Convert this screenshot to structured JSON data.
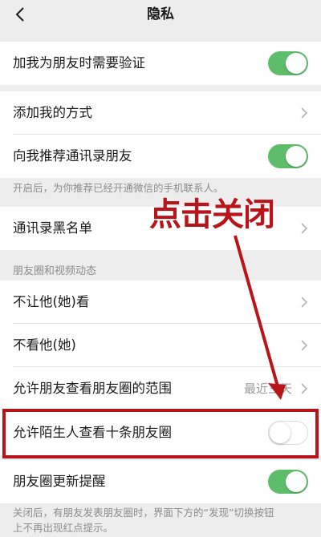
{
  "nav": {
    "title": "隐私",
    "back_icon": "chevron-left-icon"
  },
  "rows": {
    "verify": {
      "label": "加我为朋友时需要验证",
      "toggle": "on"
    },
    "add_methods": {
      "label": "添加我的方式"
    },
    "recommend_contacts": {
      "label": "向我推荐通讯录朋友",
      "toggle": "on"
    },
    "blacklist": {
      "label": "通讯录黑名单"
    },
    "hide_from": {
      "label": "不让他(她)看"
    },
    "dont_see": {
      "label": "不看他(她)"
    },
    "moments_range": {
      "label": "允许朋友查看朋友圈的范围",
      "value": "最近三天"
    },
    "stranger_ten": {
      "label": "允许陌生人查看十条朋友圈",
      "toggle": "off"
    },
    "moments_update": {
      "label": "朋友圈更新提醒",
      "toggle": "on"
    }
  },
  "notes": {
    "recommend": "开启后，为你推荐已经开通微信的手机联系人。",
    "update_line1": "关闭后，有朋友发表朋友圈时，界面下方的“发现”切换按钮",
    "update_line2": "上不再出现红点提示。"
  },
  "sections": {
    "moments": "朋友圈和视频动态"
  },
  "annotation": {
    "text": "点击关闭",
    "color": "#b8141a"
  },
  "colors": {
    "toggle_on": "#5ebd6a",
    "background": "#ededed"
  }
}
